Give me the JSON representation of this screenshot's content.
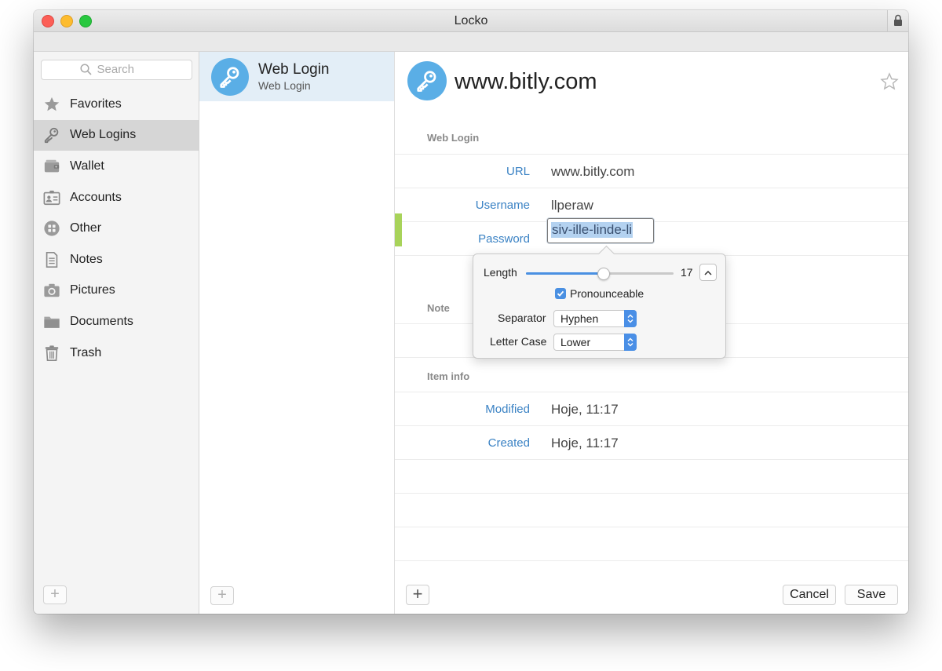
{
  "window": {
    "title": "Locko"
  },
  "sidebar": {
    "search_placeholder": "Search",
    "items": [
      {
        "label": "Favorites",
        "icon": "star-icon"
      },
      {
        "label": "Web Logins",
        "icon": "key-icon",
        "active": true
      },
      {
        "label": "Wallet",
        "icon": "wallet-icon"
      },
      {
        "label": "Accounts",
        "icon": "id-card-icon"
      },
      {
        "label": "Other",
        "icon": "grid-icon"
      },
      {
        "label": "Notes",
        "icon": "note-icon"
      },
      {
        "label": "Pictures",
        "icon": "camera-icon"
      },
      {
        "label": "Documents",
        "icon": "folder-icon"
      },
      {
        "label": "Trash",
        "icon": "trash-icon"
      }
    ],
    "add_label": "+"
  },
  "list": {
    "items": [
      {
        "title": "Web Login",
        "subtitle": "Web Login",
        "icon": "key-icon"
      }
    ],
    "add_label": "+"
  },
  "detail": {
    "title": "www.bitly.com",
    "section_web_login": "Web Login",
    "fields": {
      "url_label": "URL",
      "url_value": "www.bitly.com",
      "username_label": "Username",
      "username_value": "llperaw",
      "password_label": "Password",
      "password_value": "siv-ille-linde-li"
    },
    "section_note": "Note",
    "section_item_info": "Item info",
    "modified_label": "Modified",
    "modified_value": "Hoje, 11:17",
    "created_label": "Created",
    "created_value": "Hoje, 11:17",
    "add_label": "+",
    "cancel_label": "Cancel",
    "save_label": "Save"
  },
  "generator": {
    "length_label": "Length",
    "length_value": "17",
    "length_fraction": 0.52,
    "pronounceable_label": "Pronounceable",
    "pronounceable_checked": true,
    "separator_label": "Separator",
    "separator_value": "Hyphen",
    "letter_case_label": "Letter Case",
    "letter_case_value": "Lower"
  },
  "colors": {
    "accent": "#4a90e2",
    "label_blue": "#3a82c4",
    "strength_green": "#a8d35a",
    "selection": "#e3eef7"
  }
}
